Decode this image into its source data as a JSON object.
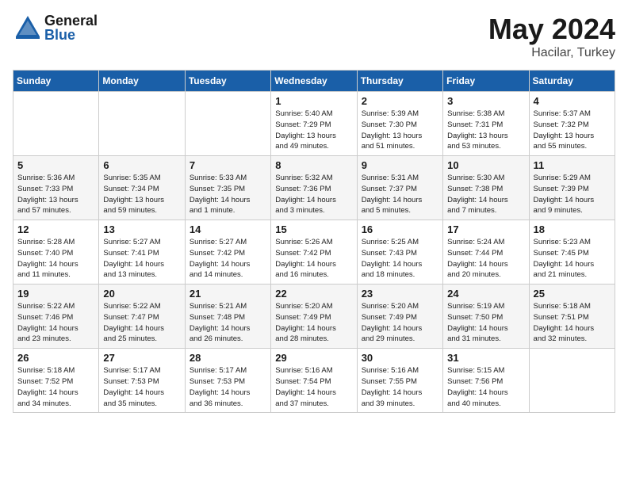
{
  "header": {
    "logo": {
      "line1": "General",
      "line2": "Blue"
    },
    "title": "May 2024",
    "subtitle": "Hacilar, Turkey"
  },
  "weekdays": [
    "Sunday",
    "Monday",
    "Tuesday",
    "Wednesday",
    "Thursday",
    "Friday",
    "Saturday"
  ],
  "weeks": [
    [
      {
        "day": "",
        "info": ""
      },
      {
        "day": "",
        "info": ""
      },
      {
        "day": "",
        "info": ""
      },
      {
        "day": "1",
        "info": "Sunrise: 5:40 AM\nSunset: 7:29 PM\nDaylight: 13 hours\nand 49 minutes."
      },
      {
        "day": "2",
        "info": "Sunrise: 5:39 AM\nSunset: 7:30 PM\nDaylight: 13 hours\nand 51 minutes."
      },
      {
        "day": "3",
        "info": "Sunrise: 5:38 AM\nSunset: 7:31 PM\nDaylight: 13 hours\nand 53 minutes."
      },
      {
        "day": "4",
        "info": "Sunrise: 5:37 AM\nSunset: 7:32 PM\nDaylight: 13 hours\nand 55 minutes."
      }
    ],
    [
      {
        "day": "5",
        "info": "Sunrise: 5:36 AM\nSunset: 7:33 PM\nDaylight: 13 hours\nand 57 minutes."
      },
      {
        "day": "6",
        "info": "Sunrise: 5:35 AM\nSunset: 7:34 PM\nDaylight: 13 hours\nand 59 minutes."
      },
      {
        "day": "7",
        "info": "Sunrise: 5:33 AM\nSunset: 7:35 PM\nDaylight: 14 hours\nand 1 minute."
      },
      {
        "day": "8",
        "info": "Sunrise: 5:32 AM\nSunset: 7:36 PM\nDaylight: 14 hours\nand 3 minutes."
      },
      {
        "day": "9",
        "info": "Sunrise: 5:31 AM\nSunset: 7:37 PM\nDaylight: 14 hours\nand 5 minutes."
      },
      {
        "day": "10",
        "info": "Sunrise: 5:30 AM\nSunset: 7:38 PM\nDaylight: 14 hours\nand 7 minutes."
      },
      {
        "day": "11",
        "info": "Sunrise: 5:29 AM\nSunset: 7:39 PM\nDaylight: 14 hours\nand 9 minutes."
      }
    ],
    [
      {
        "day": "12",
        "info": "Sunrise: 5:28 AM\nSunset: 7:40 PM\nDaylight: 14 hours\nand 11 minutes."
      },
      {
        "day": "13",
        "info": "Sunrise: 5:27 AM\nSunset: 7:41 PM\nDaylight: 14 hours\nand 13 minutes."
      },
      {
        "day": "14",
        "info": "Sunrise: 5:27 AM\nSunset: 7:42 PM\nDaylight: 14 hours\nand 14 minutes."
      },
      {
        "day": "15",
        "info": "Sunrise: 5:26 AM\nSunset: 7:42 PM\nDaylight: 14 hours\nand 16 minutes."
      },
      {
        "day": "16",
        "info": "Sunrise: 5:25 AM\nSunset: 7:43 PM\nDaylight: 14 hours\nand 18 minutes."
      },
      {
        "day": "17",
        "info": "Sunrise: 5:24 AM\nSunset: 7:44 PM\nDaylight: 14 hours\nand 20 minutes."
      },
      {
        "day": "18",
        "info": "Sunrise: 5:23 AM\nSunset: 7:45 PM\nDaylight: 14 hours\nand 21 minutes."
      }
    ],
    [
      {
        "day": "19",
        "info": "Sunrise: 5:22 AM\nSunset: 7:46 PM\nDaylight: 14 hours\nand 23 minutes."
      },
      {
        "day": "20",
        "info": "Sunrise: 5:22 AM\nSunset: 7:47 PM\nDaylight: 14 hours\nand 25 minutes."
      },
      {
        "day": "21",
        "info": "Sunrise: 5:21 AM\nSunset: 7:48 PM\nDaylight: 14 hours\nand 26 minutes."
      },
      {
        "day": "22",
        "info": "Sunrise: 5:20 AM\nSunset: 7:49 PM\nDaylight: 14 hours\nand 28 minutes."
      },
      {
        "day": "23",
        "info": "Sunrise: 5:20 AM\nSunset: 7:49 PM\nDaylight: 14 hours\nand 29 minutes."
      },
      {
        "day": "24",
        "info": "Sunrise: 5:19 AM\nSunset: 7:50 PM\nDaylight: 14 hours\nand 31 minutes."
      },
      {
        "day": "25",
        "info": "Sunrise: 5:18 AM\nSunset: 7:51 PM\nDaylight: 14 hours\nand 32 minutes."
      }
    ],
    [
      {
        "day": "26",
        "info": "Sunrise: 5:18 AM\nSunset: 7:52 PM\nDaylight: 14 hours\nand 34 minutes."
      },
      {
        "day": "27",
        "info": "Sunrise: 5:17 AM\nSunset: 7:53 PM\nDaylight: 14 hours\nand 35 minutes."
      },
      {
        "day": "28",
        "info": "Sunrise: 5:17 AM\nSunset: 7:53 PM\nDaylight: 14 hours\nand 36 minutes."
      },
      {
        "day": "29",
        "info": "Sunrise: 5:16 AM\nSunset: 7:54 PM\nDaylight: 14 hours\nand 37 minutes."
      },
      {
        "day": "30",
        "info": "Sunrise: 5:16 AM\nSunset: 7:55 PM\nDaylight: 14 hours\nand 39 minutes."
      },
      {
        "day": "31",
        "info": "Sunrise: 5:15 AM\nSunset: 7:56 PM\nDaylight: 14 hours\nand 40 minutes."
      },
      {
        "day": "",
        "info": ""
      }
    ]
  ]
}
